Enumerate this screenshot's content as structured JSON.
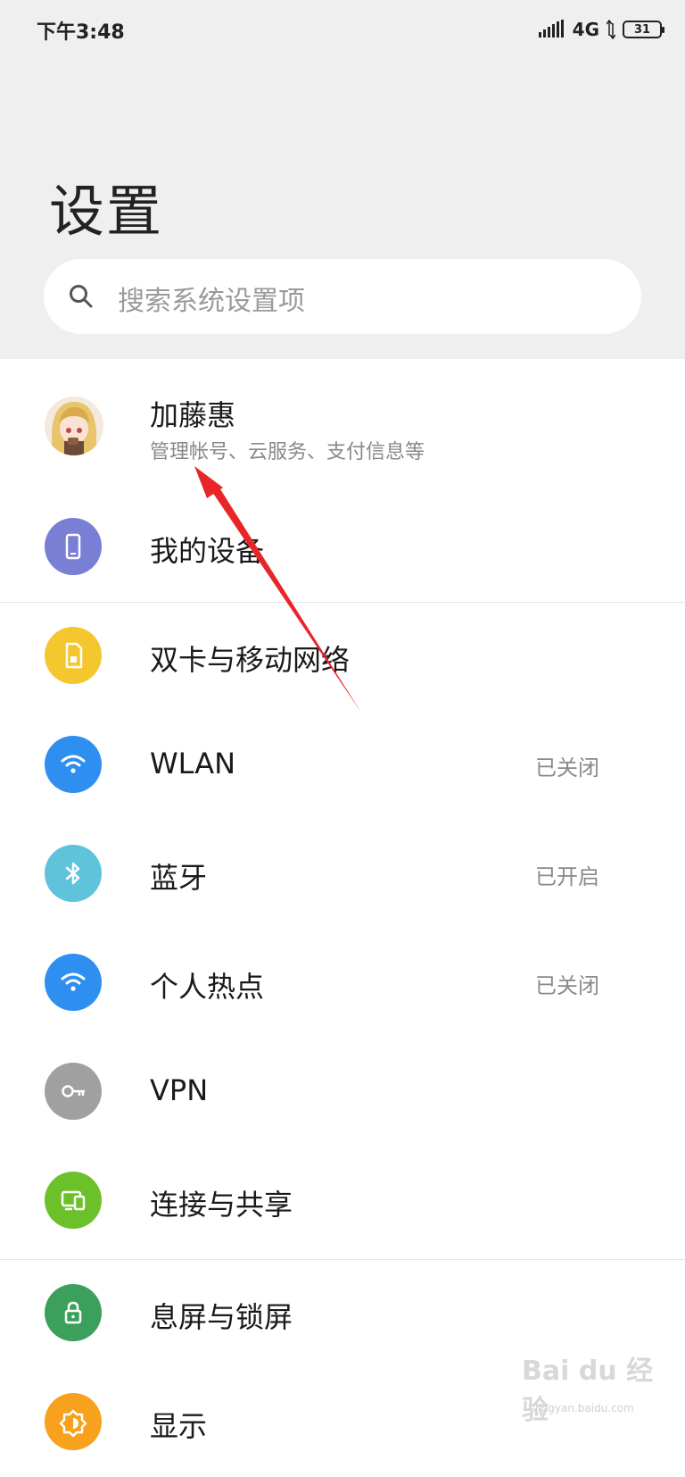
{
  "status_bar": {
    "time": "下午3:48",
    "network": "4G",
    "battery": "31"
  },
  "page": {
    "title": "设置"
  },
  "search": {
    "placeholder": "搜索系统设置项"
  },
  "account": {
    "name": "加藤惠",
    "subtitle": "管理帐号、云服务、支付信息等"
  },
  "items": [
    {
      "label": "我的设备",
      "status": "",
      "icon": "phone-icon",
      "color": "#7a7fd6"
    },
    {
      "label": "双卡与移动网络",
      "status": "",
      "icon": "sim-card-icon",
      "color": "#f5c72f"
    },
    {
      "label": "WLAN",
      "status": "已关闭",
      "icon": "wifi-icon",
      "color": "#2f8ff0"
    },
    {
      "label": "蓝牙",
      "status": "已开启",
      "icon": "bluetooth-icon",
      "color": "#5fc3dc"
    },
    {
      "label": "个人热点",
      "status": "已关闭",
      "icon": "hotspot-icon",
      "color": "#2f8ff0"
    },
    {
      "label": "VPN",
      "status": "",
      "icon": "key-icon",
      "color": "#a0a0a0"
    },
    {
      "label": "连接与共享",
      "status": "",
      "icon": "devices-icon",
      "color": "#6cc12a"
    },
    {
      "label": "息屏与锁屏",
      "status": "",
      "icon": "lock-icon",
      "color": "#3aa05c"
    },
    {
      "label": "显示",
      "status": "",
      "icon": "brightness-icon",
      "color": "#f7a11c"
    }
  ],
  "watermark": {
    "brand": "Bai du 经验",
    "url": "jingyan.baidu.com"
  }
}
